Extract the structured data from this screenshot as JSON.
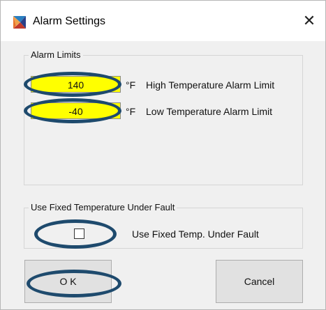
{
  "window": {
    "title": "Alarm Settings",
    "close_glyph": "✕",
    "icon_name": "app-logo-icon",
    "accent_color": "#1e4a6d",
    "field_color": "#ffff00"
  },
  "alarm_limits": {
    "group_label": "Alarm Limits",
    "high": {
      "value": "140",
      "unit": "°F",
      "label": "High Temperature Alarm Limit"
    },
    "low": {
      "value": "-40",
      "unit": "°F",
      "label": "Low Temperature Alarm Limit"
    }
  },
  "fixed_temp": {
    "group_label": "Use Fixed Temperature Under Fault",
    "checkbox_label": "Use Fixed Temp. Under Fault",
    "checked": false
  },
  "buttons": {
    "ok": "O K",
    "cancel": "Cancel"
  }
}
